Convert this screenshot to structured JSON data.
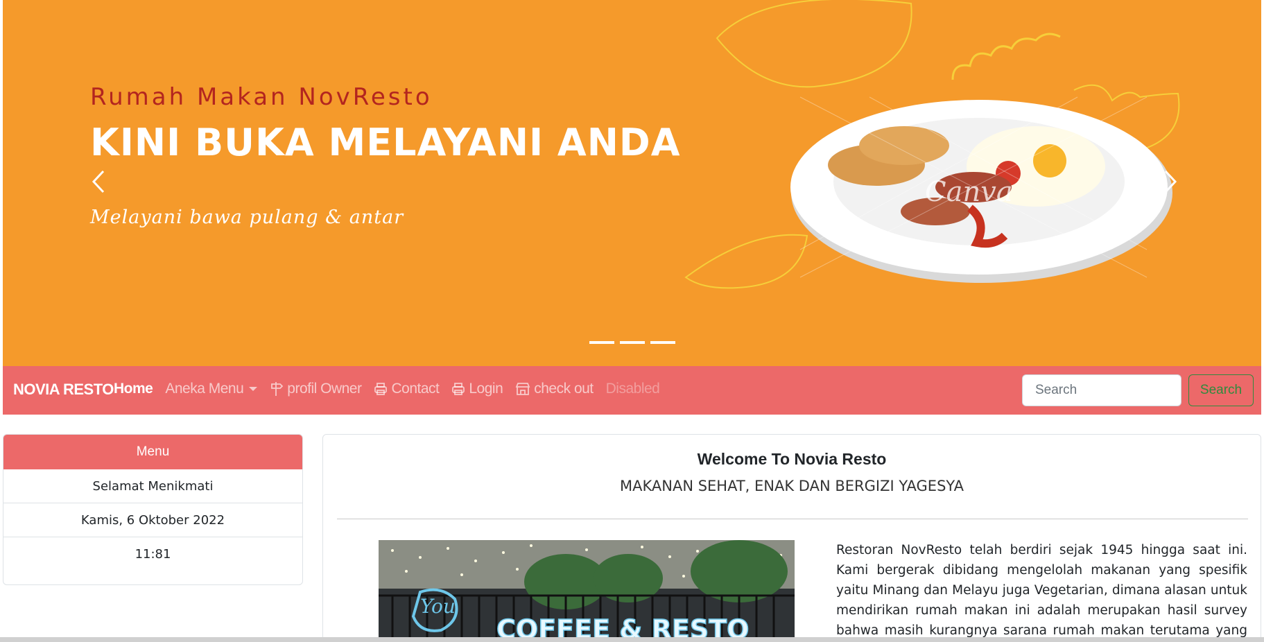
{
  "hero": {
    "title_small": "Rumah Makan NovResto",
    "title_big": "KINI BUKA MELAYANI ANDA",
    "subtitle": "Melayani bawa pulang & antar",
    "watermark": "Canva",
    "prev_icon": "chevron-left-icon",
    "next_icon": "chevron-right-icon",
    "indicator_count": 3,
    "colors": {
      "background": "#f59a2b",
      "title_small": "#b3251f",
      "title_big": "#ffffff"
    }
  },
  "navbar": {
    "brand": "NOVIA RESTO",
    "links": {
      "home": "Home",
      "aneka_menu": "Aneka Menu",
      "profil_owner": "profil Owner",
      "contact": "Contact",
      "login": "Login",
      "checkout": "check out",
      "disabled": "Disabled"
    },
    "icons": {
      "profil_owner": "signpost-icon",
      "contact": "printer-icon",
      "login": "printer-icon",
      "checkout": "shop-icon"
    },
    "search_placeholder": "Search",
    "search_button": "Search",
    "colors": {
      "background": "#ec6969",
      "search_button": "#2e8b3e"
    }
  },
  "sidebar": {
    "header": "Menu",
    "items": [
      "Selamat Menikmati",
      "Kamis, 6 Oktober 2022",
      "11:81"
    ]
  },
  "main": {
    "title": "Welcome To Novia Resto",
    "subtitle": "MAKANAN SEHAT, ENAK DAN BERGIZI YAGESYA",
    "photo_sign_script": "You",
    "photo_sign_text": "COFFEE & RESTO",
    "paragraph": "Restoran NovResto telah berdiri sejak 1945 hingga saat ini. Kami bergerak dibidang mengelolah makanan yang spesifik yaitu Minang dan Melayu juga Vegetarian, dimana alasan untuk mendirikan rumah makan ini adalah merupakan hasil survey bahwa masih kurangnya sarana rumah makan terutama yang menyediakan makanan spesifik"
  }
}
